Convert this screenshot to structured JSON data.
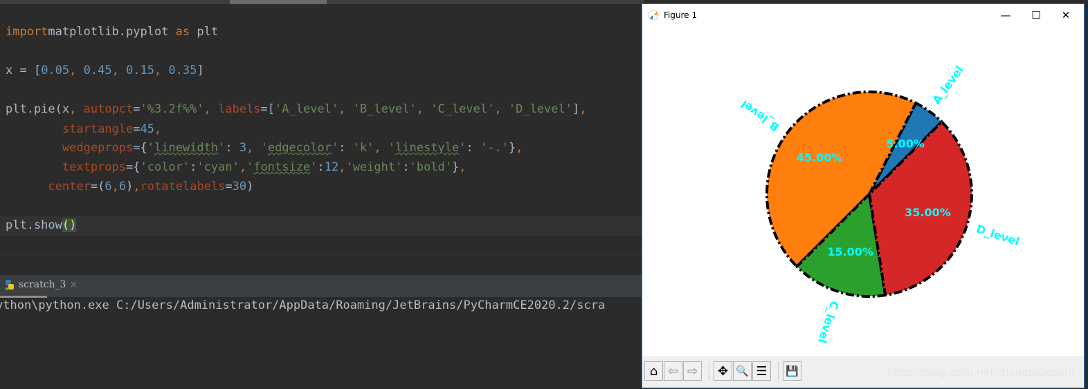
{
  "editor": {
    "lines": [
      [
        [
          "kw",
          "import"
        ],
        [
          "",
          "matplotlib.pyplot "
        ],
        [
          "kw",
          "as"
        ],
        [
          "",
          " plt"
        ]
      ],
      [
        [
          "",
          "x = ["
        ],
        [
          "nu",
          "0.05"
        ],
        [
          "kw",
          ", "
        ],
        [
          "nu",
          "0.45"
        ],
        [
          "kw",
          ", "
        ],
        [
          "nu",
          "0.15"
        ],
        [
          "kw",
          ", "
        ],
        [
          "nu",
          "0.35"
        ],
        [
          "",
          "]"
        ]
      ],
      [
        [
          "",
          "plt.pie(x"
        ],
        [
          "kw",
          ", "
        ],
        [
          "pa",
          "autopct"
        ],
        [
          "",
          "="
        ],
        [
          "st",
          "'%3.2f%%'"
        ],
        [
          "kw",
          ", "
        ],
        [
          "pa",
          "labels"
        ],
        [
          "",
          "=["
        ],
        [
          "st",
          "'A_level'"
        ],
        [
          "kw",
          ", "
        ],
        [
          "st",
          "'B_level'"
        ],
        [
          "kw",
          ", "
        ],
        [
          "st",
          "'C_level'"
        ],
        [
          "kw",
          ", "
        ],
        [
          "st",
          "'D_level'"
        ],
        [
          "",
          "]"
        ],
        [
          "kw",
          ","
        ]
      ],
      [
        [
          "",
          "        "
        ],
        [
          "pa",
          "startangle"
        ],
        [
          "",
          "="
        ],
        [
          "nu",
          "45"
        ],
        [
          "kw",
          ","
        ]
      ],
      [
        [
          "",
          "        "
        ],
        [
          "pa",
          "wedgeprops"
        ],
        [
          "",
          "={"
        ],
        [
          "st",
          "'"
        ],
        [
          "sq",
          "linewidth"
        ],
        [
          "st",
          "'"
        ],
        [
          "",
          ": "
        ],
        [
          "nu",
          "3"
        ],
        [
          "kw",
          ", "
        ],
        [
          "st",
          "'"
        ],
        [
          "sq",
          "edgecolor"
        ],
        [
          "st",
          "'"
        ],
        [
          "",
          ": "
        ],
        [
          "st",
          "'k'"
        ],
        [
          "kw",
          ", "
        ],
        [
          "st",
          "'"
        ],
        [
          "sq",
          "linestyle"
        ],
        [
          "st",
          "'"
        ],
        [
          "",
          ": "
        ],
        [
          "st",
          "'-.'"
        ],
        [
          "",
          "}"
        ],
        [
          "kw",
          ","
        ]
      ],
      [
        [
          "",
          "        "
        ],
        [
          "pa",
          "textprops"
        ],
        [
          "",
          "={"
        ],
        [
          "st",
          "'color'"
        ],
        [
          "",
          ":"
        ],
        [
          "st",
          "'cyan'"
        ],
        [
          "kw",
          ","
        ],
        [
          "st",
          "'"
        ],
        [
          "sq",
          "fontsize"
        ],
        [
          "st",
          "'"
        ],
        [
          "",
          ":"
        ],
        [
          "nu",
          "12"
        ],
        [
          "kw",
          ","
        ],
        [
          "st",
          "'weight'"
        ],
        [
          "",
          ":"
        ],
        [
          "st",
          "'bold'"
        ],
        [
          "",
          "}"
        ],
        [
          "kw",
          ","
        ]
      ],
      [
        [
          "",
          "      "
        ],
        [
          "pa",
          "center"
        ],
        [
          "",
          "=("
        ],
        [
          "nu",
          "6"
        ],
        [
          "kw",
          ","
        ],
        [
          "nu",
          "6"
        ],
        [
          "",
          ")"
        ],
        [
          "kw",
          ","
        ],
        [
          "pa",
          "rotatelabels"
        ],
        [
          "",
          "="
        ],
        [
          "nu",
          "30"
        ],
        [
          "",
          ")"
        ]
      ],
      [
        [
          "",
          "plt.show"
        ],
        [
          "br",
          "()"
        ]
      ]
    ]
  },
  "run_tab": {
    "label": "scratch_3",
    "close": "×"
  },
  "terminal": {
    "output": "ython\\python.exe C:/Users/Administrator/AppData/Roaming/JetBrains/PyCharmCE2020.2/scra"
  },
  "figure": {
    "title": "Figure 1",
    "window_buttons": {
      "minimize": "—",
      "maximize": "☐",
      "close": "✕"
    },
    "toolbar": [
      {
        "name": "home",
        "glyph": "⌂"
      },
      {
        "name": "back",
        "glyph": "⇦"
      },
      {
        "name": "forward",
        "glyph": "⇨"
      },
      {
        "name": "pan",
        "glyph": "✥"
      },
      {
        "name": "zoom",
        "glyph": "🔍"
      },
      {
        "name": "configure",
        "glyph": "☰"
      },
      {
        "name": "save",
        "glyph": "💾"
      }
    ],
    "watermark": "https://blog.csdn.net/chongbaikaishi"
  },
  "chart_data": {
    "type": "pie",
    "categories": [
      "A_level",
      "B_level",
      "C_level",
      "D_level"
    ],
    "values": [
      0.05,
      0.45,
      0.15,
      0.35
    ],
    "pct_labels": [
      "5.00%",
      "45.00%",
      "15.00%",
      "35.00%"
    ],
    "colors": [
      "#1f77b4",
      "#ff7f0e",
      "#2ca02c",
      "#d62728"
    ],
    "startangle": 45,
    "text_color": "#00ffff",
    "edgecolor": "#000000",
    "linestyle": "-.",
    "rotatelabels": true
  }
}
